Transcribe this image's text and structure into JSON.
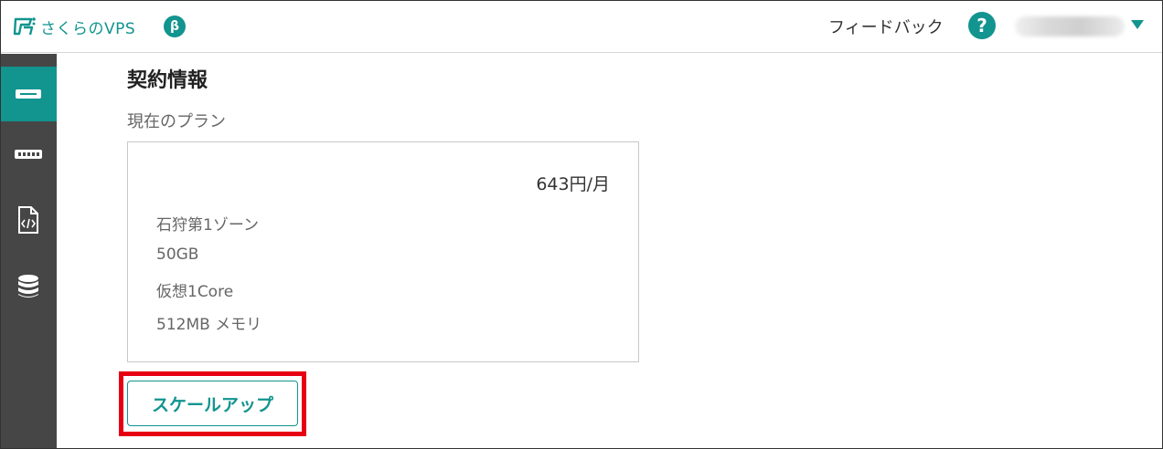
{
  "header": {
    "logo_text": "さくらのVPS",
    "beta_label": "β",
    "feedback_label": "フィードバック",
    "help_label": "?"
  },
  "colors": {
    "accent": "#12948f",
    "sidebar_bg": "#464646",
    "highlight": "#e60012"
  },
  "sidebar": {
    "items": [
      {
        "icon": "server-icon",
        "active": true
      },
      {
        "icon": "switch-icon",
        "active": false
      },
      {
        "icon": "script-file-icon",
        "active": false
      },
      {
        "icon": "database-icon",
        "active": false
      }
    ]
  },
  "main": {
    "section_title": "契約情報",
    "plan_label": "現在のプラン",
    "plan": {
      "price": "643円/月",
      "specs": [
        "石狩第1ゾーン",
        "50GB",
        "仮想1Core",
        "512MB メモリ"
      ]
    },
    "scale_up_label": "スケールアップ"
  }
}
